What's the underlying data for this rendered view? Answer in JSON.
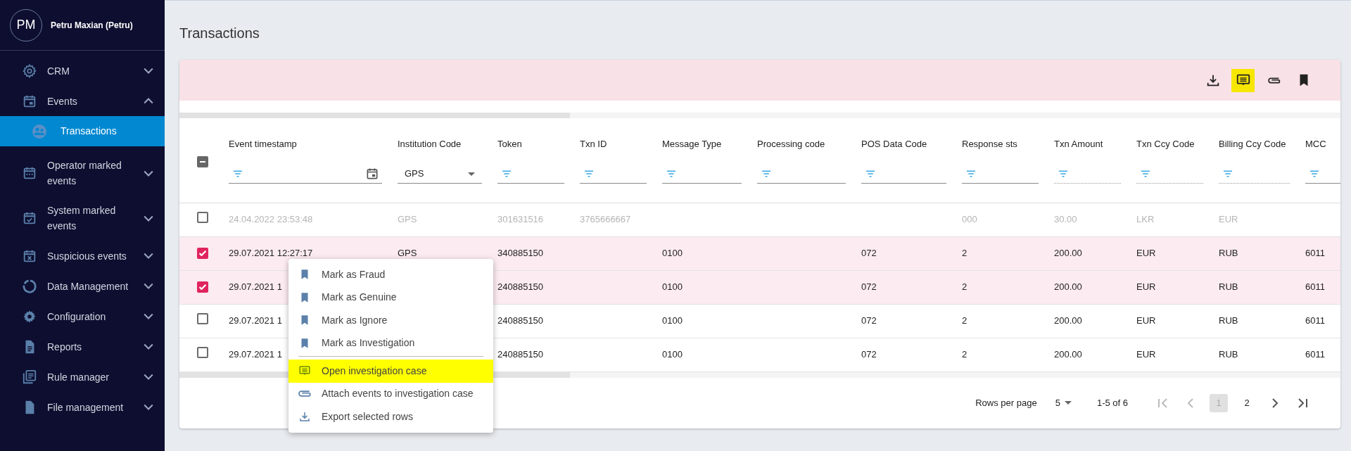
{
  "user": {
    "initials": "PM",
    "name": "Petru Maxian (Petru)"
  },
  "sidebar": {
    "items": [
      {
        "kind": "gear",
        "label": "CRM",
        "expanded": false
      },
      {
        "kind": "calendar",
        "label": "Events",
        "expanded": true,
        "children": [
          {
            "kind": "group",
            "label": "Transactions",
            "selected": true
          }
        ]
      },
      {
        "kind": "calendar-dots",
        "label": "Operator marked events",
        "expanded": false
      },
      {
        "kind": "calendar-check",
        "label": "System marked events",
        "expanded": false
      },
      {
        "kind": "calendar-x",
        "label": "Suspicious events",
        "expanded": false
      },
      {
        "kind": "donut",
        "label": "Data Management",
        "expanded": false
      },
      {
        "kind": "cog",
        "label": "Configuration",
        "expanded": false
      },
      {
        "kind": "doc",
        "label": "Reports",
        "expanded": false
      },
      {
        "kind": "stack",
        "label": "Rule manager",
        "expanded": false
      },
      {
        "kind": "file",
        "label": "File management",
        "expanded": false
      }
    ]
  },
  "page_title": "Transactions",
  "toolbar": [
    {
      "kind": "download",
      "highlighted": false
    },
    {
      "kind": "comment",
      "highlighted": true
    },
    {
      "kind": "attach",
      "highlighted": false
    },
    {
      "kind": "bookmark",
      "highlighted": false
    }
  ],
  "table": {
    "header_checkbox": {
      "indeterminate": true
    },
    "columns": [
      {
        "label": "Event timestamp",
        "kind": "date",
        "disabled": false
      },
      {
        "label": "Institution Code",
        "kind": "select",
        "value": "GPS",
        "disabled": false
      },
      {
        "label": "Token",
        "kind": "text",
        "disabled": false
      },
      {
        "label": "Txn ID",
        "kind": "text",
        "disabled": false
      },
      {
        "label": "Message Type",
        "kind": "text",
        "disabled": false
      },
      {
        "label": "Processing code",
        "kind": "text",
        "disabled": false
      },
      {
        "label": "POS Data Code",
        "kind": "text",
        "disabled": false
      },
      {
        "label": "Response sts",
        "kind": "text",
        "disabled": false
      },
      {
        "label": "Txn Amount",
        "kind": "text",
        "disabled": true
      },
      {
        "label": "Txn Ccy Code",
        "kind": "text",
        "disabled": true
      },
      {
        "label": "Billing Ccy Code",
        "kind": "text",
        "disabled": true
      },
      {
        "label": "MCC",
        "kind": "text",
        "disabled": false
      }
    ],
    "rows": [
      {
        "selected": false,
        "disabled": true,
        "cells": [
          "24.04.2022 23:53:48",
          "GPS",
          "301631516",
          "3765666667",
          null,
          null,
          null,
          "000",
          "30.00",
          "LKR",
          "EUR",
          null
        ]
      },
      {
        "selected": true,
        "disabled": false,
        "cells": [
          "29.07.2021 12:27:17",
          "GPS",
          "340885150",
          null,
          "0100",
          null,
          "072",
          "2",
          "200.00",
          "EUR",
          "RUB",
          "6011"
        ]
      },
      {
        "selected": true,
        "disabled": false,
        "cells": [
          "29.07.2021 1",
          null,
          "240885150",
          null,
          "0100",
          null,
          "072",
          "2",
          "200.00",
          "EUR",
          "RUB",
          "6011"
        ]
      },
      {
        "selected": false,
        "disabled": false,
        "cells": [
          "29.07.2021 1",
          null,
          "240885150",
          null,
          "0100",
          null,
          "072",
          "2",
          "200.00",
          "EUR",
          "RUB",
          "6011"
        ]
      },
      {
        "selected": false,
        "disabled": false,
        "cells": [
          "29.07.2021 1",
          null,
          "240885150",
          null,
          "0100",
          null,
          "072",
          "2",
          "200.00",
          "EUR",
          "RUB",
          "6011"
        ]
      }
    ]
  },
  "pagination": {
    "rows_per_page_label": "Rows per page",
    "rows_per_page": "5",
    "range": "1-5 of 6",
    "buttons": [
      {
        "kind": "first",
        "disabled": true
      },
      {
        "kind": "prev",
        "disabled": true
      },
      {
        "kind": "page",
        "label": "1",
        "selected": true
      },
      {
        "kind": "page",
        "label": "2",
        "selected": false
      },
      {
        "kind": "next",
        "disabled": false
      },
      {
        "kind": "last",
        "disabled": false
      }
    ]
  },
  "context_menu": {
    "items": [
      {
        "kind": "mark",
        "label": "Mark as Fraud",
        "highlighted": false
      },
      {
        "kind": "mark",
        "label": "Mark as Genuine",
        "highlighted": false
      },
      {
        "kind": "mark",
        "label": "Mark as Ignore",
        "highlighted": false
      },
      {
        "kind": "mark",
        "label": "Mark as Investigation",
        "highlighted": false
      },
      {
        "kind": "divider"
      },
      {
        "kind": "open",
        "label": "Open investigation case",
        "highlighted": true
      },
      {
        "kind": "attach",
        "label": "Attach events to investigation case",
        "highlighted": false
      },
      {
        "kind": "export",
        "label": "Export selected rows",
        "highlighted": false
      }
    ]
  }
}
